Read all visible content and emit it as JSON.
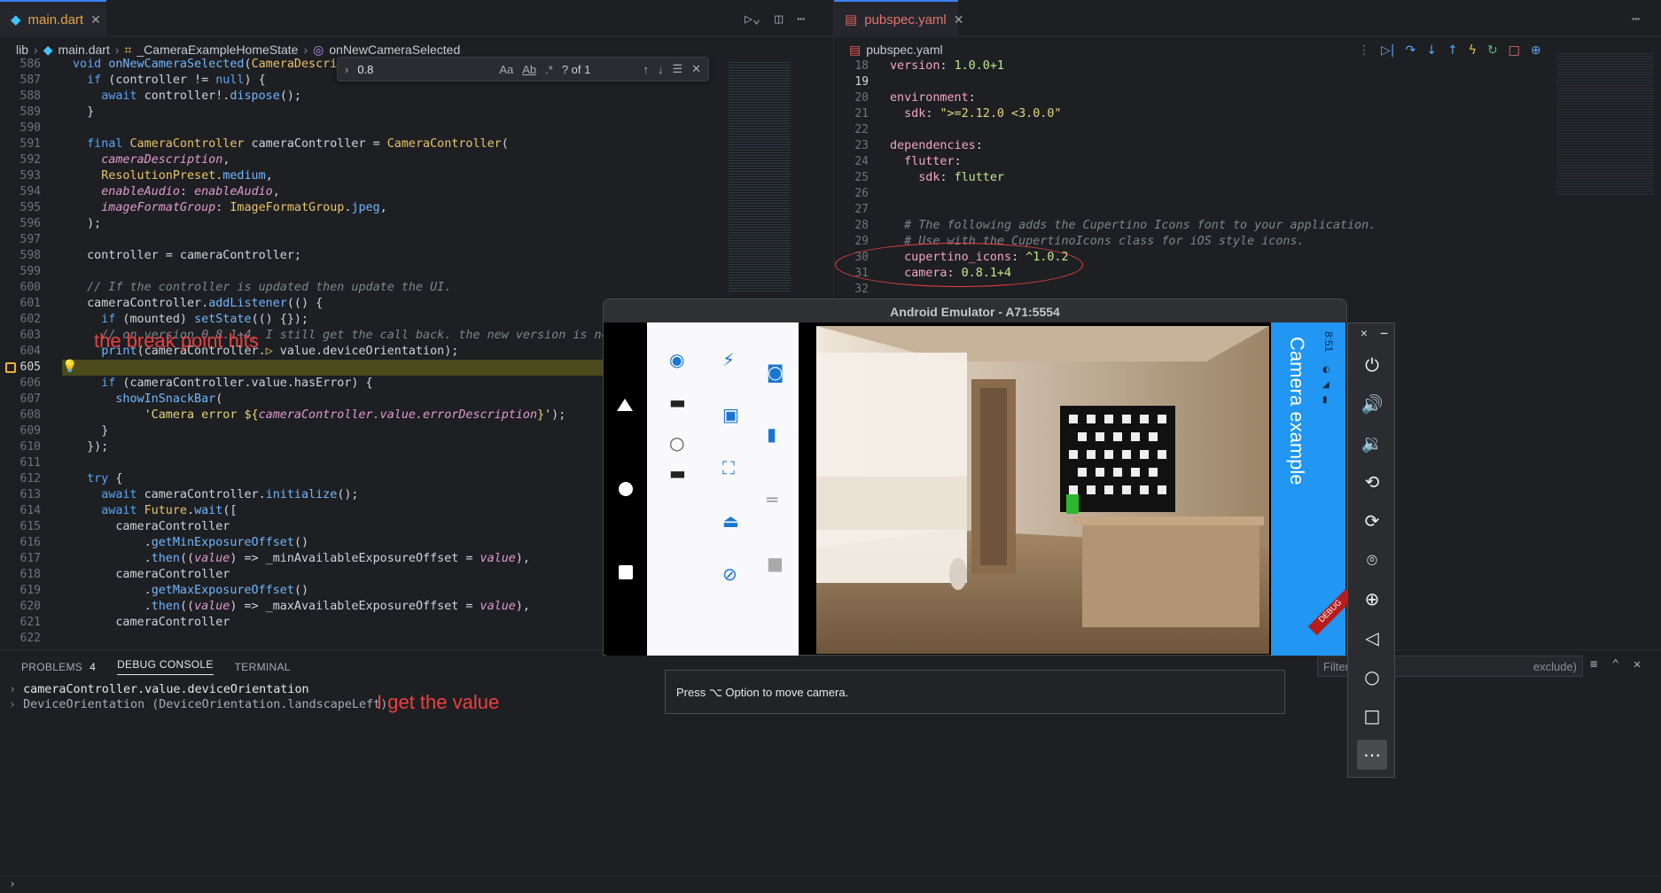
{
  "left_editor": {
    "tab_label": "main.dart",
    "breadcrumb": [
      "lib",
      "main.dart",
      "_CameraExampleHomeState",
      "onNewCameraSelected"
    ],
    "find": {
      "value": "0.8",
      "result": "? of 1",
      "opt_case": "Aa",
      "opt_word": "Ab",
      "opt_regex": ".*"
    },
    "line_numbers": [
      "586",
      "587",
      "588",
      "589",
      "590",
      "591",
      "592",
      "593",
      "594",
      "595",
      "596",
      "597",
      "598",
      "599",
      "600",
      "601",
      "602",
      "603",
      "604",
      "605",
      "606",
      "607",
      "608",
      "609",
      "610",
      "611",
      "612",
      "613",
      "614",
      "615",
      "616",
      "617",
      "618",
      "619",
      "620",
      "621",
      "622"
    ],
    "breakpoint_line": "605"
  },
  "right_editor": {
    "tab_label": "pubspec.yaml",
    "breadcrumb": "pubspec.yaml",
    "line_numbers": [
      "18",
      "19",
      "20",
      "21",
      "22",
      "23",
      "24",
      "25",
      "26",
      "27",
      "28",
      "29",
      "30",
      "31",
      "32"
    ]
  },
  "annotations": {
    "breakpoint": "the break point hits",
    "value": "I get the value"
  },
  "bottom_panel": {
    "tabs": [
      "PROBLEMS",
      "DEBUG CONSOLE",
      "TERMINAL"
    ],
    "problems_count": "4",
    "expression": "cameraController.value.deviceOrientation",
    "result": "DeviceOrientation (DeviceOrientation.landscapeLeft)",
    "filter_placeholder": "Filter",
    "filter_tail": "exclude)"
  },
  "emulator": {
    "title": "Android Emulator - A71:5554",
    "app_title": "Camera example",
    "status_time": "8:51",
    "debug_label": "DEBUG",
    "tooltip": "Press ⌥ Option to move camera.",
    "colors": {
      "app_bar": "#2196f3",
      "accent": "#1976d2"
    }
  },
  "icons": [
    "close-icon",
    "minimize-icon",
    "power-icon",
    "volume-up-icon",
    "volume-down-icon",
    "rotate-left-icon",
    "rotate-right-icon",
    "camera-icon",
    "zoom-icon",
    "back-icon",
    "home-icon",
    "overview-icon",
    "more-icon"
  ]
}
